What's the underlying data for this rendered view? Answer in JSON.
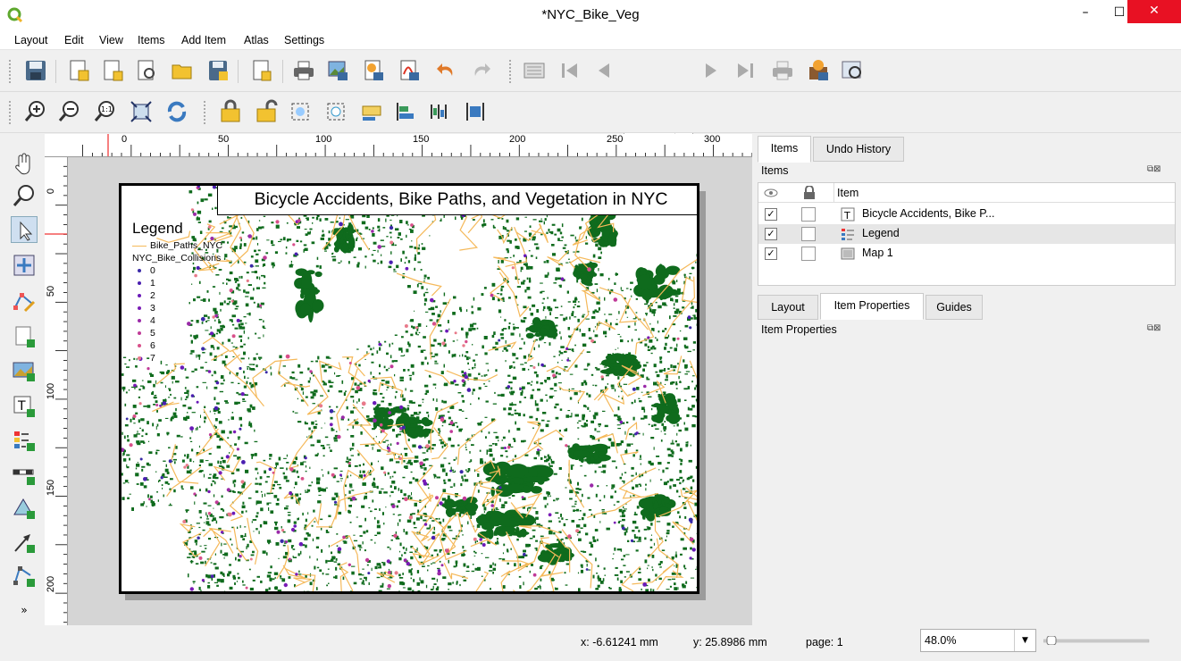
{
  "window": {
    "title": "*NYC_Bike_Veg",
    "minimize": "–",
    "maximize": "☐",
    "close": "✕"
  },
  "menu": [
    "Layout",
    "Edit",
    "View",
    "Items",
    "Add Item",
    "Atlas",
    "Settings"
  ],
  "toolbar": {
    "page_number": "1"
  },
  "ruler": {
    "h_labels": [
      "0",
      "50",
      "100",
      "150",
      "200",
      "250",
      "300"
    ],
    "v_labels": [
      "0",
      "50",
      "100",
      "150",
      "200"
    ]
  },
  "layout": {
    "map_title": "Bicycle Accidents, Bike Paths, and Vegetation in NYC",
    "legend": {
      "title": "Legend",
      "line_layer": "Bike_Paths_NYC",
      "point_layer": "NYC_Bike_Collisions",
      "classes": [
        "0",
        "1",
        "2",
        "3",
        "4",
        "5",
        "6",
        "7"
      ],
      "class_colors": [
        "#3b2aa8",
        "#4a1fb0",
        "#6a1ab8",
        "#7a1bb5",
        "#9a2aa8",
        "#c03a98",
        "#d8508a",
        "#e87a8a"
      ]
    },
    "colors": {
      "vegetation": "#0f6b1d",
      "bike_paths": "#f5b95a",
      "collisions": "#6b23b8"
    }
  },
  "right_panel": {
    "top_tabs": [
      "Items",
      "Undo History"
    ],
    "items_label": "Items",
    "items_header": "Item",
    "items": [
      {
        "name": "Bicycle Accidents, Bike P...",
        "visible": "✓",
        "icon": "text-icon"
      },
      {
        "name": "Legend",
        "visible": "✓",
        "icon": "legend-icon"
      },
      {
        "name": "Map 1",
        "visible": "✓",
        "icon": "map-icon"
      }
    ],
    "bottom_tabs": [
      "Layout",
      "Item Properties",
      "Guides"
    ],
    "properties_label": "Item Properties",
    "float_close": "⧉⊠"
  },
  "status": {
    "x": "x: -6.61241 mm",
    "y": "y: 25.8986 mm",
    "page": "page: 1",
    "zoom": "48.0%"
  }
}
